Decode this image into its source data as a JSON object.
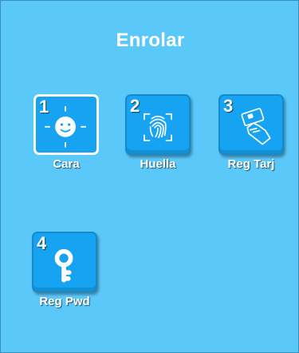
{
  "screen": {
    "title": "Enrolar"
  },
  "tiles": [
    {
      "number": "1",
      "label": "Cara",
      "icon": "face-icon",
      "selected": true
    },
    {
      "number": "2",
      "label": "Huella",
      "icon": "fingerprint-icon",
      "selected": false
    },
    {
      "number": "3",
      "label": "Reg Tarj",
      "icon": "card-hand-icon",
      "selected": false
    },
    {
      "number": "4",
      "label": "Reg Pwd",
      "icon": "key-icon",
      "selected": false
    }
  ],
  "colors": {
    "background": "#5bc8fa",
    "tile": "#16a4f2",
    "text": "#ffffff"
  }
}
